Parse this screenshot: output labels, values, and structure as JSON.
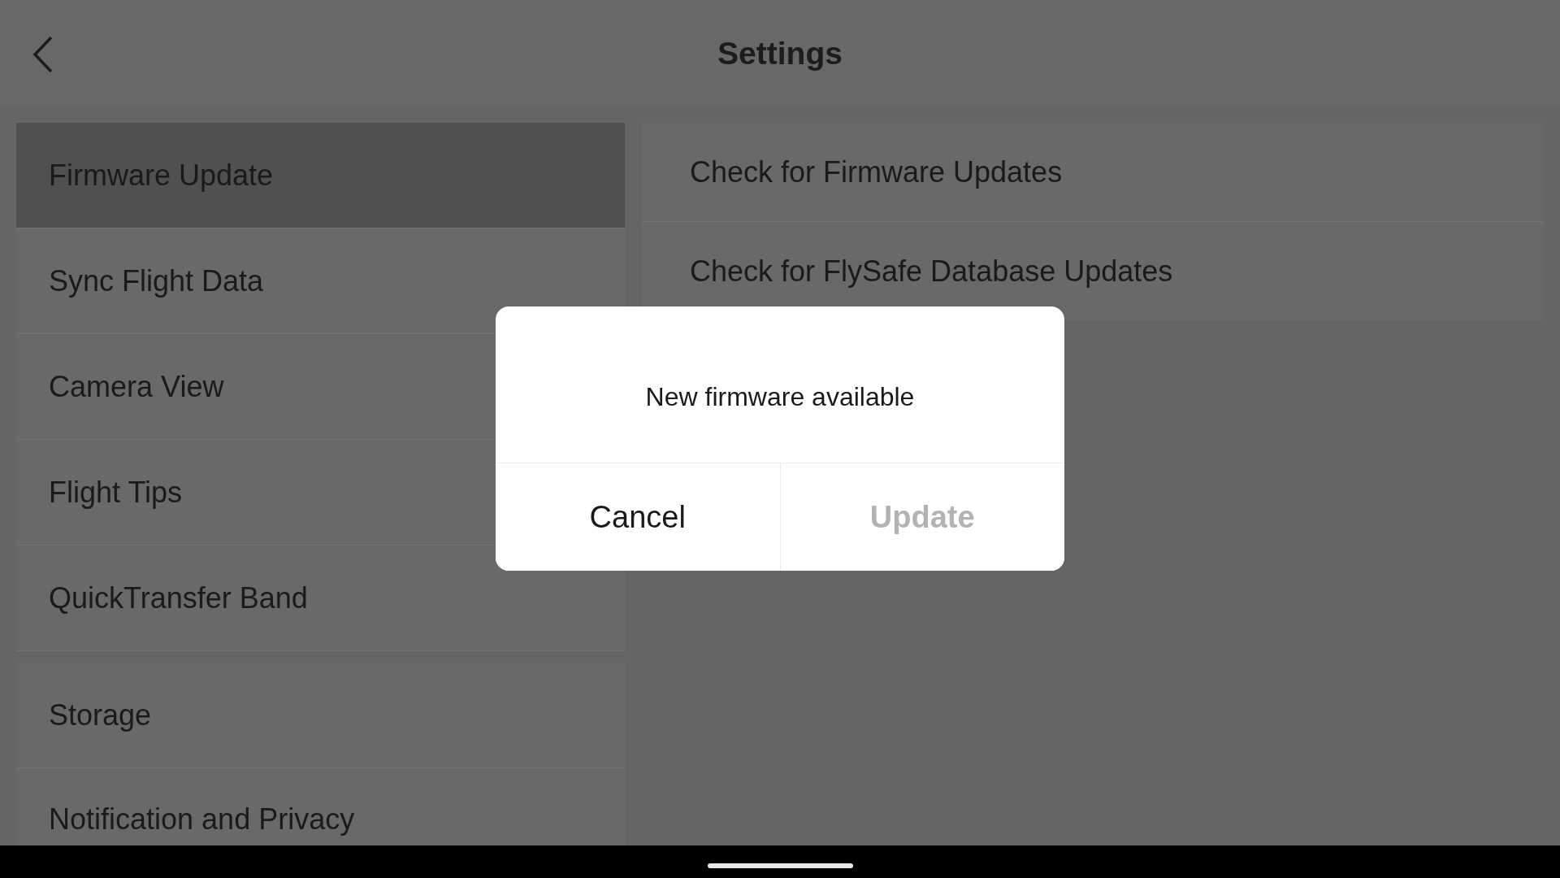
{
  "header": {
    "title": "Settings"
  },
  "sidebar": {
    "groups": [
      {
        "items": [
          {
            "label": "Firmware Update",
            "selected": true
          },
          {
            "label": "Sync Flight Data",
            "selected": false
          },
          {
            "label": "Camera View",
            "selected": false
          },
          {
            "label": "Flight Tips",
            "selected": false
          },
          {
            "label": "QuickTransfer Band",
            "selected": false
          }
        ]
      },
      {
        "items": [
          {
            "label": "Storage",
            "selected": false
          },
          {
            "label": "Notification and Privacy",
            "selected": false
          }
        ]
      }
    ]
  },
  "content": {
    "items": [
      {
        "label": "Check for Firmware Updates"
      },
      {
        "label": "Check for FlySafe Database Updates"
      }
    ]
  },
  "dialog": {
    "message": "New firmware available",
    "buttons": [
      {
        "label": "Cancel",
        "disabled": false
      },
      {
        "label": "Update",
        "disabled": true
      }
    ]
  }
}
